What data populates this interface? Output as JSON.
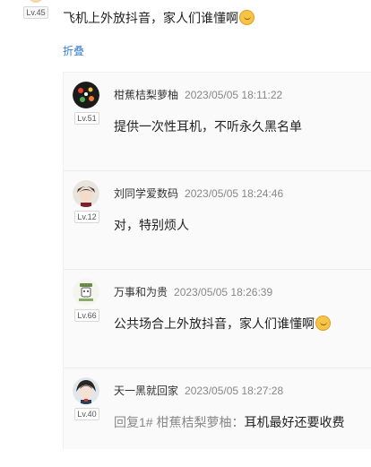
{
  "main_comment": {
    "level_badge": "Lv.45",
    "text": "飞机上外放抖音，家人们谁懂啊",
    "collapse_label": "折叠"
  },
  "replies": [
    {
      "username": "柑蕉桔梨萝柚",
      "time": "2023/05/05 18:11:22",
      "level": "Lv.51",
      "content": "提供一次性耳机，不听永久黑名单"
    },
    {
      "username": "刘同学爱数码",
      "time": "2023/05/05 18:24:46",
      "level": "Lv.12",
      "content": "对，特别烦人"
    },
    {
      "username": "万事和为贵",
      "time": "2023/05/05 18:26:39",
      "level": "Lv.66",
      "content": "公共场合上外放抖音，家人们谁懂啊"
    },
    {
      "username": "天一黑就回家",
      "time": "2023/05/05 18:27:28",
      "level": "Lv.40",
      "reply_prefix": "回复1# 柑蕉桔梨萝柚：",
      "content": "耳机最好还要收费"
    }
  ],
  "icons": {
    "emoji": "laughing-emoji-icon"
  },
  "colors": {
    "link": "#3a7fcf",
    "timestamp": "#888888",
    "reply_background": "#fafafa"
  }
}
